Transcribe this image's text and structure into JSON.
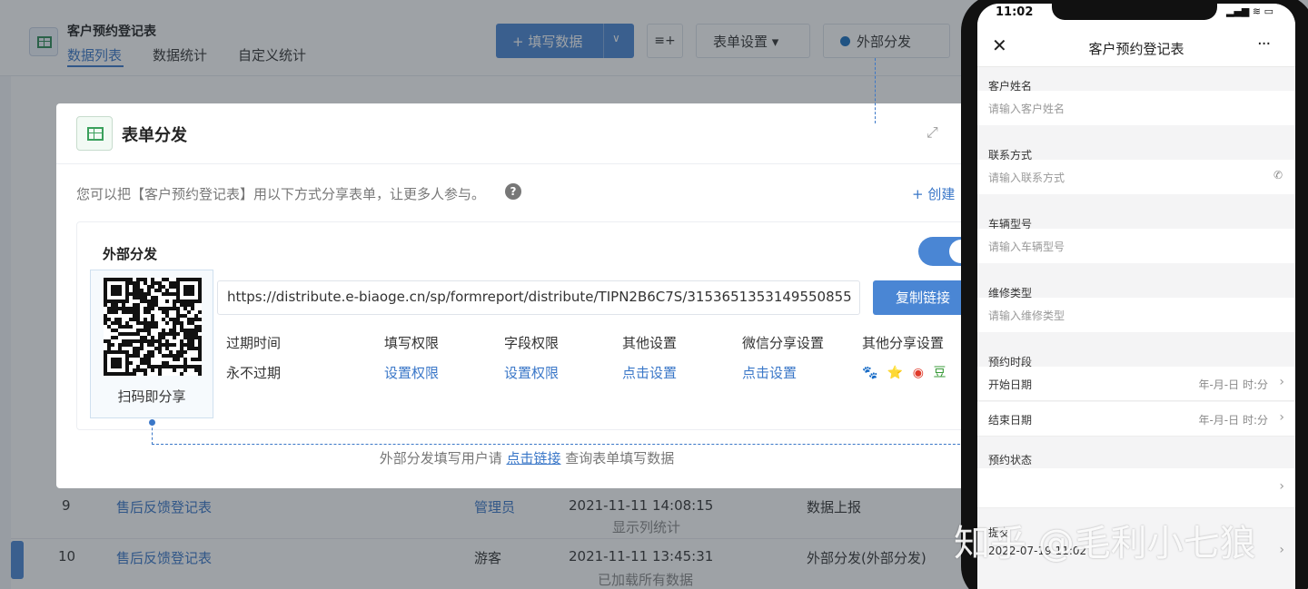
{
  "app": {
    "title": "客户预约登记表",
    "tabs": [
      "数据列表",
      "数据统计",
      "自定义统计"
    ],
    "toolbar": {
      "fill_label": "+ 填写数据",
      "fill_caret": "∨",
      "batch_label": "≡+",
      "form_settings_label": "表单设置 ▾",
      "external_label": "外部分发"
    },
    "rows": [
      {
        "num": "9",
        "name": "售后反馈登记表",
        "user": "管理员",
        "time": "2021-11-11 14:08:15",
        "source": "数据上报"
      },
      {
        "num": "10",
        "name": "售后反馈登记表",
        "user": "游客",
        "time": "2021-11-11 13:45:31",
        "source": "外部分发(外部分发)"
      }
    ],
    "row_extra_1": "显示列统计",
    "row_extra_2": "已加载所有数据"
  },
  "modal": {
    "title": "表单分发",
    "description": "您可以把【客户预约登记表】用以下方式分享表单，让更多人参与。",
    "help": "?",
    "create_link": "+ 创建",
    "expand_icon": "⤢",
    "share": {
      "title": "外部分发",
      "toggle_on": true,
      "qr_caption": "扫码即分享",
      "url": "https://distribute.e-biaoge.cn/sp/formreport/distribute/TIPN2B6C7S/3153651353149550855",
      "copy_label": "复制链接",
      "columns": [
        {
          "header": "过期时间",
          "value": "永不过期",
          "link": false
        },
        {
          "header": "填写权限",
          "value": "设置权限",
          "link": true
        },
        {
          "header": "字段权限",
          "value": "设置权限",
          "link": true
        },
        {
          "header": "其他设置",
          "value": "点击设置",
          "link": true
        },
        {
          "header": "微信分享设置",
          "value": "点击设置",
          "link": true
        },
        {
          "header": "其他分享设置",
          "value": "",
          "link": false
        }
      ],
      "share_icons": [
        "🐾",
        "⭐",
        "◉",
        "豆"
      ]
    },
    "footnote": {
      "before": "外部分发填写用户请",
      "link": "点击链接",
      "after": "查询表单填写数据"
    }
  },
  "phone": {
    "time": "11:02",
    "status_icons": "▂▄▆ ≋ ▭",
    "title": "客户预约登记表",
    "close_icon": "✕",
    "more_icon": "···",
    "fields": [
      {
        "label": "客户姓名",
        "placeholder": "请输入客户姓名",
        "icon": ""
      },
      {
        "label": "联系方式",
        "placeholder": "请输入联系方式",
        "icon": "✆"
      },
      {
        "label": "车辆型号",
        "placeholder": "请输入车辆型号",
        "icon": ""
      },
      {
        "label": "维修类型",
        "placeholder": "请输入维修类型",
        "icon": ""
      }
    ],
    "period_label": "预约时段",
    "start_label": "开始日期",
    "start_value": "年-月-日 时:分",
    "end_label": "结束日期",
    "end_value": "年-月-日 时:分",
    "status_label": "预约状态",
    "submit_label": "提交",
    "submit_value": "2022-07-19 11:02"
  },
  "watermark": "知乎 @毛利小七狼"
}
